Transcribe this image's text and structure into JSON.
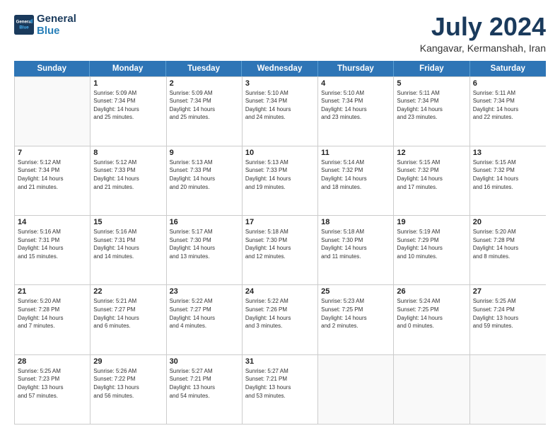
{
  "logo": {
    "line1": "General",
    "line2": "Blue"
  },
  "title": "July 2024",
  "location": "Kangavar, Kermanshah, Iran",
  "weekdays": [
    "Sunday",
    "Monday",
    "Tuesday",
    "Wednesday",
    "Thursday",
    "Friday",
    "Saturday"
  ],
  "rows": [
    [
      {
        "date": "",
        "info": ""
      },
      {
        "date": "1",
        "info": "Sunrise: 5:09 AM\nSunset: 7:34 PM\nDaylight: 14 hours\nand 25 minutes."
      },
      {
        "date": "2",
        "info": "Sunrise: 5:09 AM\nSunset: 7:34 PM\nDaylight: 14 hours\nand 25 minutes."
      },
      {
        "date": "3",
        "info": "Sunrise: 5:10 AM\nSunset: 7:34 PM\nDaylight: 14 hours\nand 24 minutes."
      },
      {
        "date": "4",
        "info": "Sunrise: 5:10 AM\nSunset: 7:34 PM\nDaylight: 14 hours\nand 23 minutes."
      },
      {
        "date": "5",
        "info": "Sunrise: 5:11 AM\nSunset: 7:34 PM\nDaylight: 14 hours\nand 23 minutes."
      },
      {
        "date": "6",
        "info": "Sunrise: 5:11 AM\nSunset: 7:34 PM\nDaylight: 14 hours\nand 22 minutes."
      }
    ],
    [
      {
        "date": "7",
        "info": "Sunrise: 5:12 AM\nSunset: 7:34 PM\nDaylight: 14 hours\nand 21 minutes."
      },
      {
        "date": "8",
        "info": "Sunrise: 5:12 AM\nSunset: 7:33 PM\nDaylight: 14 hours\nand 21 minutes."
      },
      {
        "date": "9",
        "info": "Sunrise: 5:13 AM\nSunset: 7:33 PM\nDaylight: 14 hours\nand 20 minutes."
      },
      {
        "date": "10",
        "info": "Sunrise: 5:13 AM\nSunset: 7:33 PM\nDaylight: 14 hours\nand 19 minutes."
      },
      {
        "date": "11",
        "info": "Sunrise: 5:14 AM\nSunset: 7:32 PM\nDaylight: 14 hours\nand 18 minutes."
      },
      {
        "date": "12",
        "info": "Sunrise: 5:15 AM\nSunset: 7:32 PM\nDaylight: 14 hours\nand 17 minutes."
      },
      {
        "date": "13",
        "info": "Sunrise: 5:15 AM\nSunset: 7:32 PM\nDaylight: 14 hours\nand 16 minutes."
      }
    ],
    [
      {
        "date": "14",
        "info": "Sunrise: 5:16 AM\nSunset: 7:31 PM\nDaylight: 14 hours\nand 15 minutes."
      },
      {
        "date": "15",
        "info": "Sunrise: 5:16 AM\nSunset: 7:31 PM\nDaylight: 14 hours\nand 14 minutes."
      },
      {
        "date": "16",
        "info": "Sunrise: 5:17 AM\nSunset: 7:30 PM\nDaylight: 14 hours\nand 13 minutes."
      },
      {
        "date": "17",
        "info": "Sunrise: 5:18 AM\nSunset: 7:30 PM\nDaylight: 14 hours\nand 12 minutes."
      },
      {
        "date": "18",
        "info": "Sunrise: 5:18 AM\nSunset: 7:30 PM\nDaylight: 14 hours\nand 11 minutes."
      },
      {
        "date": "19",
        "info": "Sunrise: 5:19 AM\nSunset: 7:29 PM\nDaylight: 14 hours\nand 10 minutes."
      },
      {
        "date": "20",
        "info": "Sunrise: 5:20 AM\nSunset: 7:28 PM\nDaylight: 14 hours\nand 8 minutes."
      }
    ],
    [
      {
        "date": "21",
        "info": "Sunrise: 5:20 AM\nSunset: 7:28 PM\nDaylight: 14 hours\nand 7 minutes."
      },
      {
        "date": "22",
        "info": "Sunrise: 5:21 AM\nSunset: 7:27 PM\nDaylight: 14 hours\nand 6 minutes."
      },
      {
        "date": "23",
        "info": "Sunrise: 5:22 AM\nSunset: 7:27 PM\nDaylight: 14 hours\nand 4 minutes."
      },
      {
        "date": "24",
        "info": "Sunrise: 5:22 AM\nSunset: 7:26 PM\nDaylight: 14 hours\nand 3 minutes."
      },
      {
        "date": "25",
        "info": "Sunrise: 5:23 AM\nSunset: 7:25 PM\nDaylight: 14 hours\nand 2 minutes."
      },
      {
        "date": "26",
        "info": "Sunrise: 5:24 AM\nSunset: 7:25 PM\nDaylight: 14 hours\nand 0 minutes."
      },
      {
        "date": "27",
        "info": "Sunrise: 5:25 AM\nSunset: 7:24 PM\nDaylight: 13 hours\nand 59 minutes."
      }
    ],
    [
      {
        "date": "28",
        "info": "Sunrise: 5:25 AM\nSunset: 7:23 PM\nDaylight: 13 hours\nand 57 minutes."
      },
      {
        "date": "29",
        "info": "Sunrise: 5:26 AM\nSunset: 7:22 PM\nDaylight: 13 hours\nand 56 minutes."
      },
      {
        "date": "30",
        "info": "Sunrise: 5:27 AM\nSunset: 7:21 PM\nDaylight: 13 hours\nand 54 minutes."
      },
      {
        "date": "31",
        "info": "Sunrise: 5:27 AM\nSunset: 7:21 PM\nDaylight: 13 hours\nand 53 minutes."
      },
      {
        "date": "",
        "info": ""
      },
      {
        "date": "",
        "info": ""
      },
      {
        "date": "",
        "info": ""
      }
    ]
  ]
}
